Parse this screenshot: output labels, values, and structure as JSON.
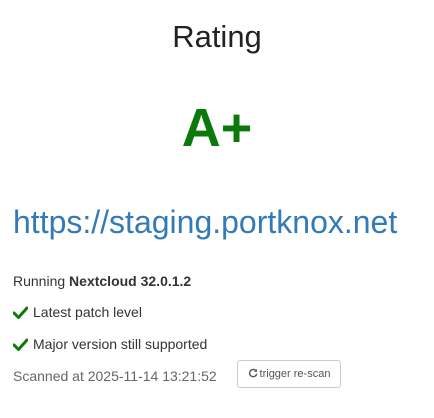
{
  "rating": {
    "heading": "Rating",
    "grade": "A+",
    "grade_color": "#0b7a0b"
  },
  "site": {
    "url": "https://staging.portknox.net",
    "link_color": "#337ab7"
  },
  "status": {
    "running_prefix": "Running",
    "product_version": "Nextcloud 32.0.1.2",
    "checks": [
      {
        "icon": "check-icon",
        "label": "Latest patch level"
      },
      {
        "icon": "check-icon",
        "label": "Major version still supported"
      }
    ],
    "check_color": "#0b7a0b"
  },
  "scan": {
    "scanned_text": "Scanned at 2025-11-14 13:21:52",
    "rescan_icon": "refresh-icon",
    "rescan_label": "trigger re-scan"
  }
}
